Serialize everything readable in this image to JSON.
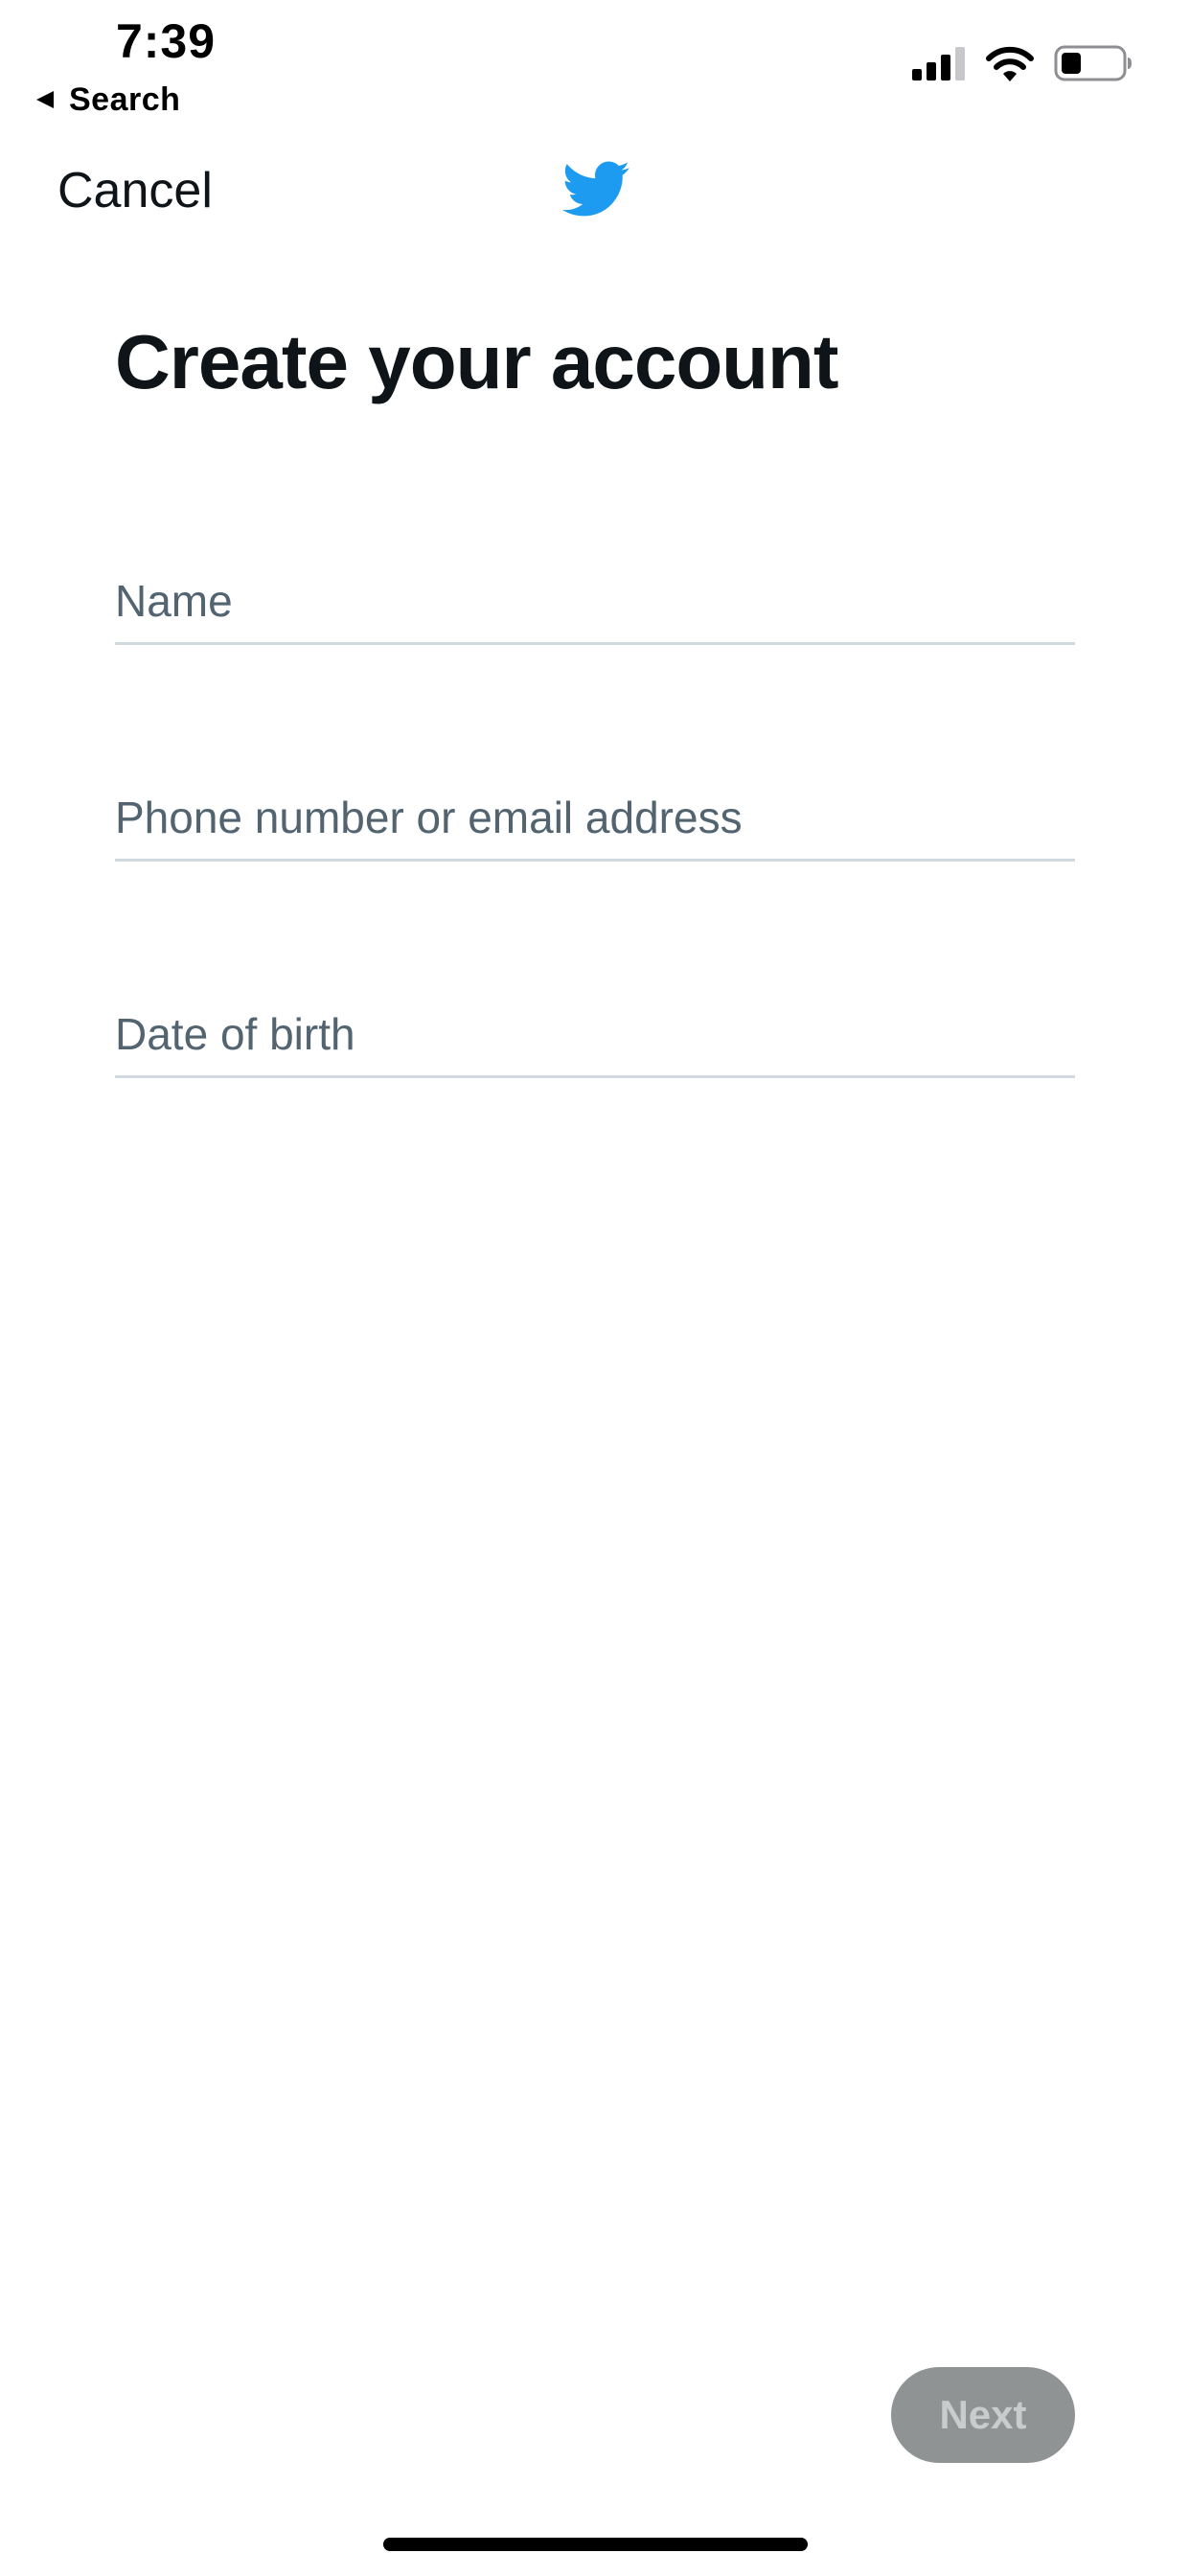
{
  "status_bar": {
    "time": "7:39",
    "back_label": "Search",
    "icons": [
      "back-triangle-icon",
      "cellular-signal-icon",
      "wifi-icon",
      "battery-icon"
    ]
  },
  "nav": {
    "cancel_label": "Cancel",
    "logo_icon": "twitter-bird-icon"
  },
  "main": {
    "title": "Create your account",
    "fields": [
      {
        "placeholder": "Name",
        "value": ""
      },
      {
        "placeholder": "Phone number or email address",
        "value": ""
      },
      {
        "placeholder": "Date of birth",
        "value": ""
      }
    ]
  },
  "footer": {
    "next_label": "Next"
  },
  "colors": {
    "brand": "#1d9bf0",
    "text_primary": "#0f1419",
    "placeholder": "#536471",
    "divider": "#cfd9de",
    "next_disabled_bg": "#8f9394",
    "next_disabled_text": "#c9cccd"
  }
}
